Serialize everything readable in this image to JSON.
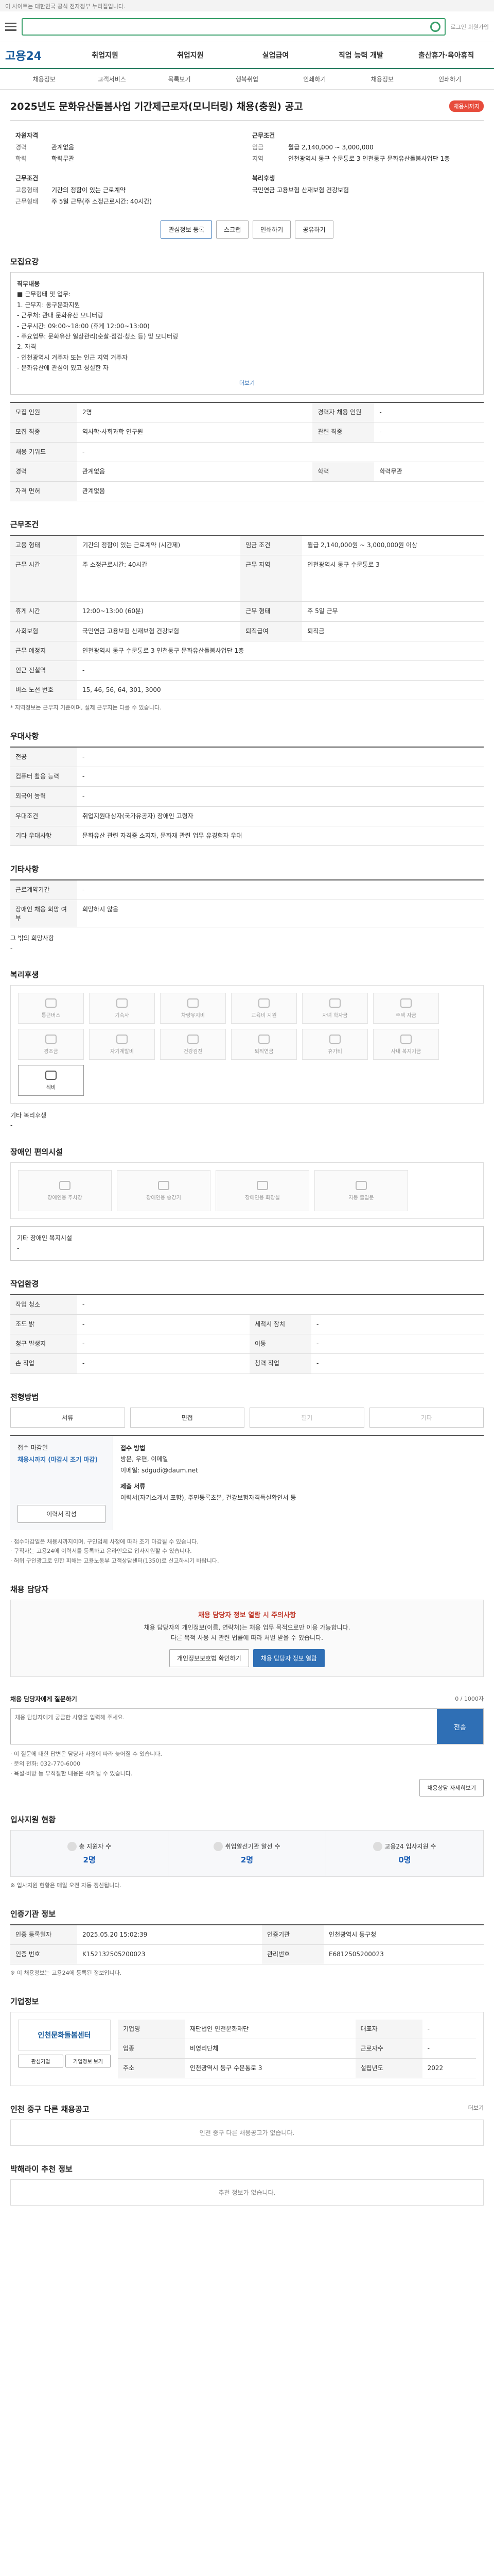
{
  "header": {
    "top_notice": "이 사이트는 대한민국 공식 전자정부 누리집입니다.",
    "search_placeholder": "",
    "links": "로그인 회원가입",
    "logo": "고용24"
  },
  "gnb": [
    "취업지원",
    "취업지원",
    "실업급여",
    "직업 능력 개발",
    "출산휴가·육아휴직"
  ],
  "lnb": [
    "채용정보",
    "고객서비스",
    "목록보기",
    "행복취업",
    "인쇄하기",
    "채용정보",
    "인쇄하기"
  ],
  "notice": {
    "title": "2025년도 문화유산돌봄사업 기간제근로자(모니터링) 채용(충원) 공고",
    "badge": "채용시까지"
  },
  "summary": {
    "left_title": "자원자격",
    "left": [
      {
        "k": "경력",
        "v": "관계없음"
      },
      {
        "k": "학력",
        "v": "학력무관"
      }
    ],
    "left_title2": "근무조건",
    "left2": [
      {
        "k": "고용형태",
        "v": "기간의 정함이 있는 근로계약"
      },
      {
        "k": "근무형태",
        "v": "주 5일 근무(주 소정근로시간: 40시간)"
      }
    ],
    "right_title": "근무조건",
    "right": [
      {
        "k": "임금",
        "v": "월급 2,140,000 ~ 3,000,000"
      },
      {
        "k": "지역",
        "v": "인천광역시 동구 수문통로 3 인천동구 문화유산돌봄사업단 1층"
      }
    ],
    "right_title2": "복리후생",
    "right2": [
      {
        "k": "",
        "v": "국민연금 고용보험 산재보험 건강보험"
      }
    ]
  },
  "buttons": {
    "apply": "관심정보 등록",
    "scrap": "스크랩",
    "print": "인쇄하기",
    "share": "공유하기"
  },
  "sec1": {
    "title": "모집요강",
    "box_title": "직무내용",
    "lines": [
      "■ 근무형태 및 업무:",
      "1. 근무지: 동구문화지원",
      "- 근무처: 관내 문화유산 모니터링",
      "- 근무시간: 09:00~18:00 (휴게 12:00~13:00)",
      "- 주요업무: 문화유산 일상관리(순찰·점검·청소 등) 및 모니터링",
      "2. 자격",
      "- 인천광역시 거주자 또는 인근 지역 거주자",
      "- 문화유산에 관심이 있고 성실한 자"
    ],
    "more": "더보기"
  },
  "sec1_rows": [
    {
      "k": "모집 인원",
      "v": "2명",
      "k2": "경력자 채용 인원",
      "v2": "-"
    },
    {
      "k": "모집 직종",
      "v": "역사학·사회과학 연구원",
      "k2": "관련 직종",
      "v2": "-"
    },
    {
      "k": "채용 키워드",
      "v": "-",
      "k2": "",
      "": ""
    },
    {
      "k": "경력",
      "v": "관계없음",
      "k2": "학력",
      "v2": "학력무관"
    },
    {
      "k": "자격 면허",
      "v": "관계없음",
      "k2": "",
      "": ""
    }
  ],
  "sec2": {
    "title": "근무조건",
    "rows": [
      {
        "k": "고용 형태",
        "v": "기간의 정함이 있는 근로계약 (시간제)",
        "k2": "임금 조건",
        "v2": "월급 2,140,000원 ~ 3,000,000원 이상"
      },
      {
        "k": "근무 시간",
        "v": "주 소정근로시간: 40시간",
        "k2": "근무 지역",
        "v2": "인천광역시 동구 수문통로 3"
      },
      {
        "k": "휴게 시간",
        "v": "12:00~13:00 (60분)",
        "k2": "근무 형태",
        "v2": "주 5일 근무"
      },
      {
        "k": "사회보험",
        "v": "국민연금 고용보험 산재보험 건강보험",
        "k2": "퇴직급여",
        "v2": "퇴직금"
      },
      {
        "k": "근무 예정지",
        "v": "인천광역시 동구 수문통로 3 인천동구 문화유산돌봄사업단 1층",
        "k2": "",
        "": ""
      },
      {
        "k": "인근 전철역",
        "v": "-",
        "k2": "",
        "": ""
      },
      {
        "k": "버스 노선 번호",
        "v": "15, 46, 56, 64, 301, 3000",
        "k2": "",
        "": ""
      }
    ],
    "note": "* 지역정보는 근무지 기준이며, 실제 근무지는 다를 수 있습니다."
  },
  "sec3": {
    "title": "우대사항",
    "rows": [
      {
        "k": "전공",
        "v": "-"
      },
      {
        "k": "컴퓨터 활용 능력",
        "v": "-"
      },
      {
        "k": "외국어 능력",
        "v": "-"
      },
      {
        "k": "우대조건",
        "v": "취업지원대상자(국가유공자) 장애인 고령자"
      },
      {
        "k": "기타 우대사항",
        "v": "문화유산 관련 자격증 소지자, 문화재 관련 업무 유경험자 우대"
      }
    ]
  },
  "sec4": {
    "title": "기타사항",
    "rows": [
      {
        "k": "근로계약기간",
        "v": "-"
      },
      {
        "k": "장애인 채용 희망 여부",
        "v": "희망하지 않음"
      }
    ],
    "note_title": "그 밖의 희망사항",
    "note": "-"
  },
  "sec5": {
    "title": "복리후생",
    "items": [
      "통근버스",
      "기숙사",
      "차량유지비",
      "교육비 지원",
      "자녀 학자금",
      "주택 자금",
      "경조금",
      "자기계발비",
      "건강검진",
      "퇴직연금",
      "휴가비",
      "사내 복지기금",
      "식비"
    ],
    "active": "식비",
    "etc_title": "기타 복리후생",
    "etc": "-"
  },
  "sec6": {
    "title": "장애인 편의시설",
    "items": [
      "장애인용 주차장",
      "장애인용 승강기",
      "장애인용 화장실",
      "자동 출입문 "
    ],
    "etc_title": "기타 장애인 복지시설",
    "etc": "-"
  },
  "sec7": {
    "title": "작업환경",
    "rows": [
      {
        "k": "작업 청소",
        "v": "-",
        "k2": "",
        "": ""
      },
      {
        "k": "조도 밝",
        "v": "-",
        "k2": "세척시 장치",
        "v2": "-"
      },
      {
        "k": "청구 발생지",
        "v": "-",
        "k2": "이동",
        "v2": "-"
      },
      {
        "k": "손 작업",
        "v": "-",
        "k2": "청력 작업",
        "v2": "-"
      }
    ]
  },
  "sec8": {
    "title": "전형방법",
    "tabs": [
      "서류",
      "면접",
      "필기",
      "기타"
    ],
    "left_title": "접수 마감일",
    "left_v": "채용시까지 (마감시 조기 마감)",
    "method_title": "접수 방법",
    "method": "방문, 우편, 이메일",
    "method2": "이메일: sdgudi@daum.net",
    "docs_title": "제출 서류",
    "docs": "이력서(자기소개서 포함), 주민등록초본, 건강보험자격득실확인서 등",
    "btn": "이력서 작성"
  },
  "notes": [
    "· 접수마감일은 채용시까지이며, 구인업체 사정에 따라 조기 마감될 수 있습니다.",
    "· 구직자는 고용24에 이력서를 등록하고 온라인으로 입사지원할 수 있습니다.",
    "· 허위 구인광고로 인한 피해는 고용노동부 고객상담센터(1350)로 신고하시기 바랍니다."
  ],
  "sec9": {
    "title": "채용 담당자",
    "alert": "채용 담당자 정보 열람 시 주의사항",
    "p1": "채용 담당자의 개인정보(이름, 연락처)는 채용 업무 목적으로만 이용 가능합니다.",
    "p2": "다른 목적 사용 시 관련 법률에 따라 처벌 받을 수 있습니다.",
    "btn1": "개인정보보호법 확인하기",
    "btn2": "채용 담당자 정보 열람"
  },
  "sec10": {
    "title": "채용 담당자에게 질문하기",
    "hint": "0 / 1000자",
    "placeholder": "채용 담당자에게 궁금한 사항을 입력해 주세요.",
    "submit": "전송",
    "notes": [
      "· 이 질문에 대한 답변은 담당자 사정에 따라 늦어질 수 있습니다.",
      "· 문의 전화: 032-770-6000",
      "· 욕설·비방 등 부적절한 내용은 삭제될 수 있습니다."
    ],
    "link": "채용상담 자세히보기"
  },
  "sec11": {
    "title": "입사지원 현황",
    "cards": [
      {
        "l": "총 지원자 수",
        "n": "2명"
      },
      {
        "l": "취업알선기관 알선 수",
        "n": "2명"
      },
      {
        "l": "고용24 입사지원 수",
        "n": "0명"
      }
    ],
    "note": "※ 입사지원 현황은 매일 오전 자동 갱신됩니다."
  },
  "sec12": {
    "title": "인증기관 정보",
    "rows": [
      {
        "k": "인증 등록일자",
        "v": "2025.05.20 15:02:39",
        "k2": "인증기관",
        "v2": "인천광역시 동구청"
      },
      {
        "k": "인증 번호",
        "v": "K152132505200023",
        "k2": "관리번호",
        "v2": "E6812505200023"
      }
    ],
    "note": "※ 이 채용정보는 고용24에 등록된 정보입니다."
  },
  "sec13": {
    "title": "기업정보",
    "company": "인천문화돌봄센터",
    "rows": [
      {
        "k": "기업명",
        "v": "재단법인 인천문화재단",
        "k2": "대표자",
        "v2": "-"
      },
      {
        "k": "업종",
        "v": "비영리단체",
        "k2": "근로자수",
        "v2": "-"
      },
      {
        "k": "주소",
        "v": "인천광역시 동구 수문통로 3",
        "k2": "설립년도",
        "v2": "2022"
      }
    ],
    "btns": [
      "관심기업",
      "기업정보 보기"
    ]
  },
  "sec14": {
    "title": "인천 중구 다른 채용공고",
    "empty": "인천 중구 다른 채용공고가 없습니다.",
    "more": "더보기"
  },
  "sec15": {
    "title": "박해라이 추천 정보",
    "empty": "추천 정보가 없습니다."
  }
}
